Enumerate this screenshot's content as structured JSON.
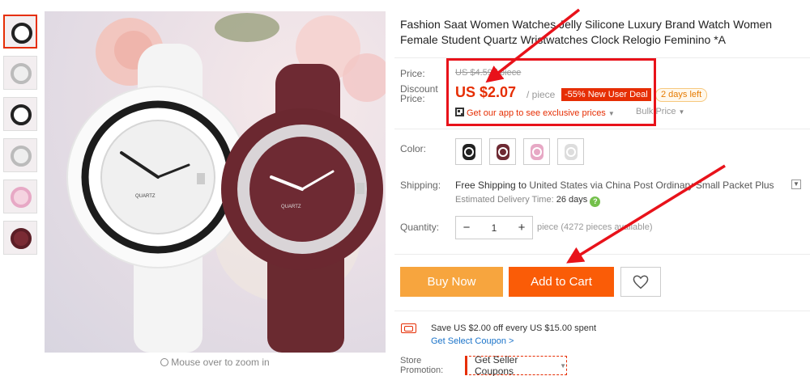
{
  "product": {
    "title": "Fashion Saat Women Watches Jelly Silicone Luxury Brand Watch Women Female Student Quartz Wristwatches Clock Relogio Feminino *A"
  },
  "gallery": {
    "thumbnails": [
      "white watch",
      "blue watch",
      "white watch small",
      "grey watch",
      "pink watch",
      "watch on wrist"
    ],
    "main_image": "white and burgundy jelly silicone watches with pink roses",
    "watch_label": "QUARTZ",
    "zoom_hint": "Mouse over to zoom in"
  },
  "price": {
    "price_label": "Price:",
    "original": "US $4.59 / piece",
    "discount_label": "Discount Price:",
    "discount_label_line1": "Discount",
    "discount_label_line2": "Price:",
    "current": "US $2.07",
    "unit": "/ piece",
    "deal_badge": "-55% New User Deal",
    "days_left": "2 days left",
    "app_prices": "Get our app to see exclusive prices",
    "bulk_price": "Bulk Price"
  },
  "color": {
    "label": "Color:",
    "swatches": [
      {
        "name": "black",
        "color": "#222222"
      },
      {
        "name": "burgundy",
        "color": "#6e2a33"
      },
      {
        "name": "pink",
        "color": "#e7a8c5"
      },
      {
        "name": "white",
        "color": "#f1f1f1"
      }
    ]
  },
  "shipping": {
    "label": "Shipping:",
    "free": "Free Shipping to",
    "destination": "United States via China Post Ordinary Small Packet Plus",
    "estimated_label": "Estimated Delivery Time:",
    "estimated_value": "26 days"
  },
  "quantity": {
    "label": "Quantity:",
    "value": "1",
    "minus": "−",
    "plus": "+",
    "available": "piece (4272 pieces available)"
  },
  "actions": {
    "buy_now": "Buy Now",
    "add_to_cart": "Add to Cart"
  },
  "promotion": {
    "save_text": "Save US $2.00 off every US $15.00 spent",
    "get_coupon": "Get Select Coupon >",
    "store_label_line1": "Store",
    "store_label_line2": "Promotion:",
    "seller_coupons": "Get Seller Coupons"
  },
  "colors": {
    "accent_red": "#e62e04",
    "buy_now_bg": "#f7a53e",
    "add_to_cart_bg": "#fa5c07",
    "annotation_red": "#e8121a"
  }
}
